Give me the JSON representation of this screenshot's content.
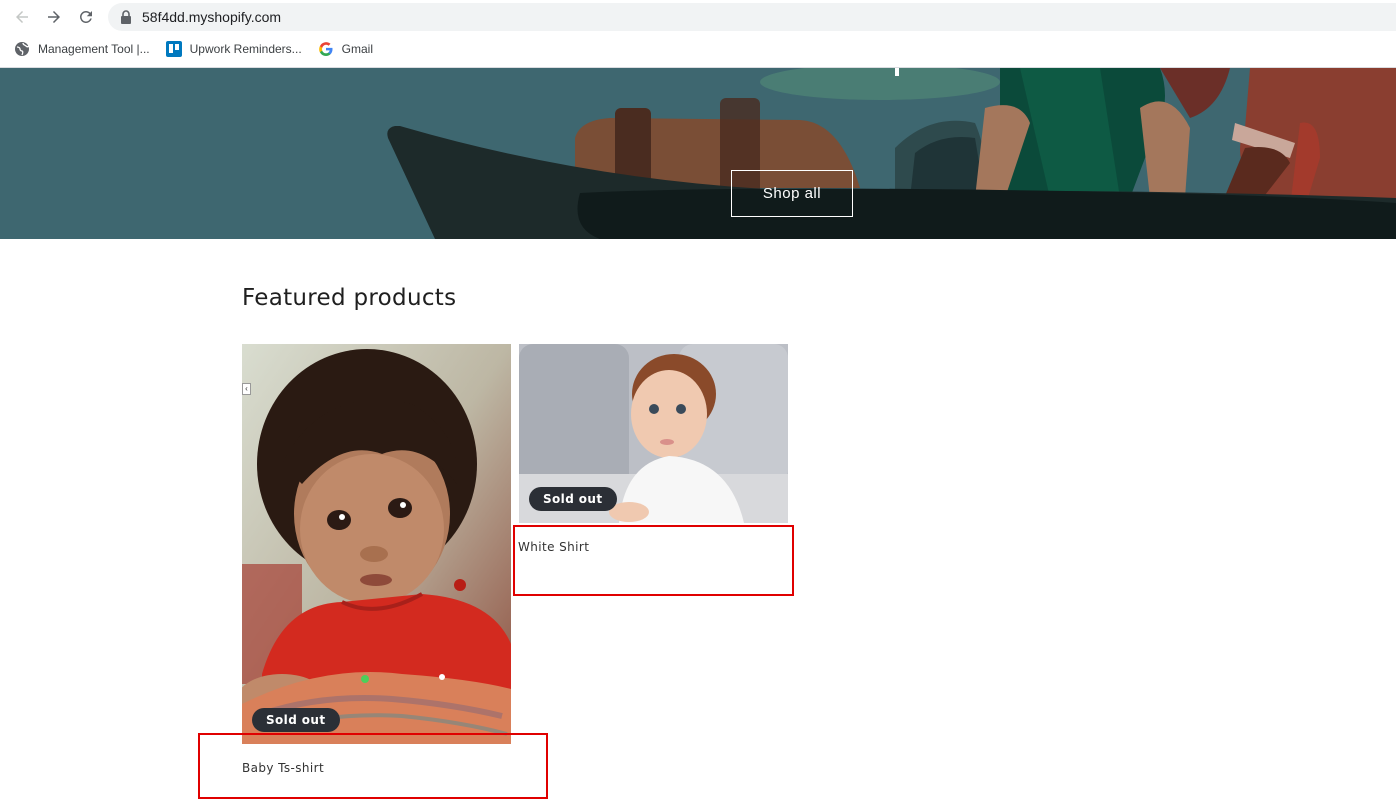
{
  "browser": {
    "url": "58f4dd.myshopify.com",
    "bookmarks": [
      {
        "label": "Management Tool |...",
        "icon": "globe-icon"
      },
      {
        "label": "Upwork Reminders...",
        "icon": "trello-icon"
      },
      {
        "label": "Gmail",
        "icon": "google-icon"
      }
    ]
  },
  "hero": {
    "button_label": "Shop all"
  },
  "featured": {
    "title": "Featured products",
    "products": [
      {
        "title": "Baby Ts-shirt",
        "badge": "Sold out"
      },
      {
        "title": "White Shirt",
        "badge": "Sold out"
      }
    ]
  },
  "colors": {
    "hero_bg": "#3e6770",
    "badge_bg": "#2b2f36",
    "highlight_border": "#e00000"
  }
}
